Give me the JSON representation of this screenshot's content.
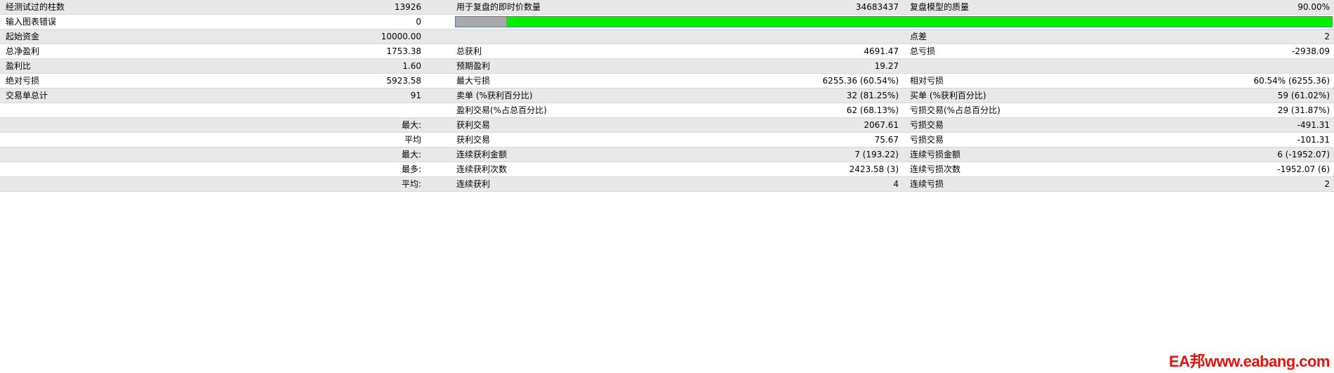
{
  "rows": [
    {
      "shade": "shaded",
      "c1": "经测试过的柱数",
      "c2": "13926",
      "c3": "用于复盘的即时价数量",
      "c4": "34683437",
      "c5": "复盘模型的质量",
      "c6": "90.00%"
    },
    {
      "shade": "plain",
      "c1": "输入图表错误",
      "c2": "0",
      "c3": "",
      "c4": "",
      "c5": "",
      "c6": ""
    },
    {
      "shade": "shaded",
      "c1": "起始资金",
      "c2": "10000.00",
      "c3": "",
      "c4": "",
      "c5": "点差",
      "c6": "2"
    },
    {
      "shade": "plain",
      "c1": "总净盈利",
      "c2": "1753.38",
      "c3": "总获利",
      "c4": "4691.47",
      "c5": "总亏损",
      "c6": "-2938.09"
    },
    {
      "shade": "shaded",
      "c1": "盈利比",
      "c2": "1.60",
      "c3": "预期盈利",
      "c4": "19.27",
      "c5": "",
      "c6": ""
    },
    {
      "shade": "plain",
      "c1": "绝对亏损",
      "c2": "5923.58",
      "c3": "最大亏损",
      "c4": "6255.36 (60.54%)",
      "c5": "相对亏损",
      "c6": "60.54% (6255.36)"
    },
    {
      "shade": "shaded",
      "c1": "交易单总计",
      "c2": "91",
      "c3": "卖单 (%获利百分比)",
      "c4": "32 (81.25%)",
      "c5": "买单 (%获利百分比)",
      "c6": "59 (61.02%)"
    },
    {
      "shade": "plain",
      "c1": "",
      "c2": "",
      "c3": "盈利交易(%占总百分比)",
      "c4": "62 (68.13%)",
      "c5": "亏损交易(%占总百分比)",
      "c6": "29 (31.87%)"
    },
    {
      "shade": "shaded",
      "c1": "",
      "c2": "最大:",
      "c3": "获利交易",
      "c4": "2067.61",
      "c5": "亏损交易",
      "c6": "-491.31"
    },
    {
      "shade": "plain",
      "c1": "",
      "c2": "平均",
      "c3": "获利交易",
      "c4": "75.67",
      "c5": "亏损交易",
      "c6": "-101.31"
    },
    {
      "shade": "shaded",
      "c1": "",
      "c2": "最大:",
      "c3": "连续获利金额",
      "c4": "7 (193.22)",
      "c5": "连续亏损金额",
      "c6": "6 (-1952.07)"
    },
    {
      "shade": "plain",
      "c1": "",
      "c2": "最多:",
      "c3": "连续获利次数",
      "c4": "2423.58 (3)",
      "c5": "连续亏损次数",
      "c6": "-1952.07 (6)"
    },
    {
      "shade": "shaded",
      "c1": "",
      "c2": "平均:",
      "c3": "连续获利",
      "c4": "4",
      "c5": "连续亏损",
      "c6": "2"
    }
  ],
  "quality_bar": {
    "gray_fraction": 0.058,
    "fill_color": "#00ee00",
    "gray_color": "#a9a9a9"
  },
  "watermark": {
    "text": "EA邦www.eabang.com",
    "color": "#e8120c"
  }
}
